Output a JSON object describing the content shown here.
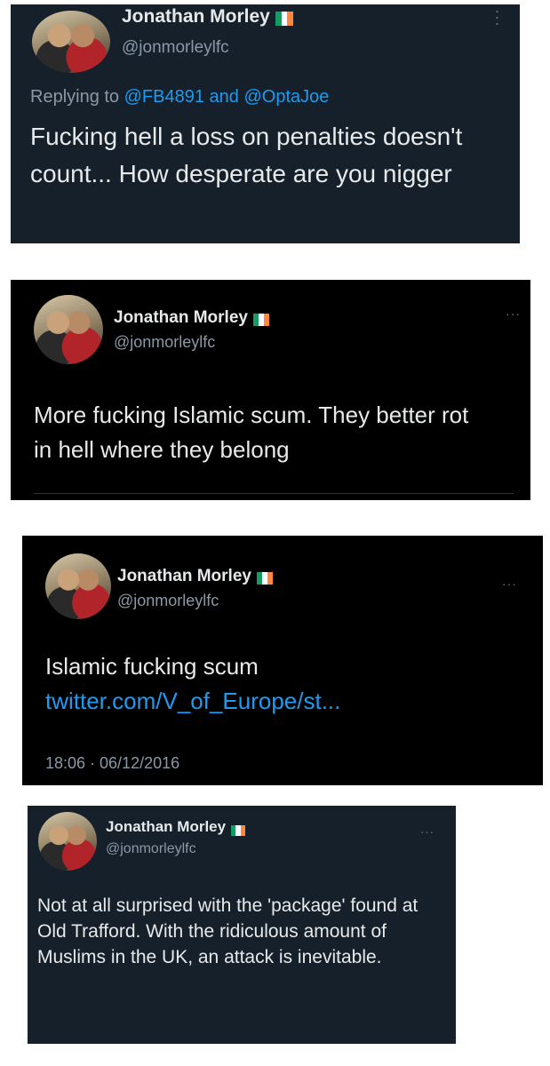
{
  "flag_colors": [
    "#169b62",
    "#ffffff",
    "#ff883e"
  ],
  "tweets": [
    {
      "name": "Jonathan Morley",
      "handle": "@jonmorleylfc",
      "replying_prefix": "Replying to ",
      "replying_user1": "@FB4891",
      "replying_and": " and ",
      "replying_user2": "@OptaJoe",
      "text": "Fucking hell a loss on penalties doesn't count... How desperate are you nigger",
      "more_icon": "vertical-dots-icon",
      "background": "#15202b"
    },
    {
      "name": "Jonathan Morley",
      "handle": "@jonmorleylfc",
      "text": "More fucking Islamic scum. They better rot in hell where they belong",
      "more_icon": "horizontal-dots-icon",
      "background": "#000000"
    },
    {
      "name": "Jonathan Morley",
      "handle": "@jonmorleylfc",
      "text": "Islamic fucking scum ",
      "link_text": "twitter.com/V_of_Europe/st...",
      "timestamp": "18:06 · 06/12/2016",
      "more_icon": "horizontal-dots-icon",
      "background": "#000000"
    },
    {
      "name": "Jonathan Morley",
      "handle": "@jonmorleylfc",
      "text": "Not at all surprised with the 'package' found at Old Trafford. With the ridiculous amount of Muslims in the UK, an attack is inevitable.",
      "more_icon": "horizontal-dots-icon",
      "background": "#15202b"
    }
  ]
}
